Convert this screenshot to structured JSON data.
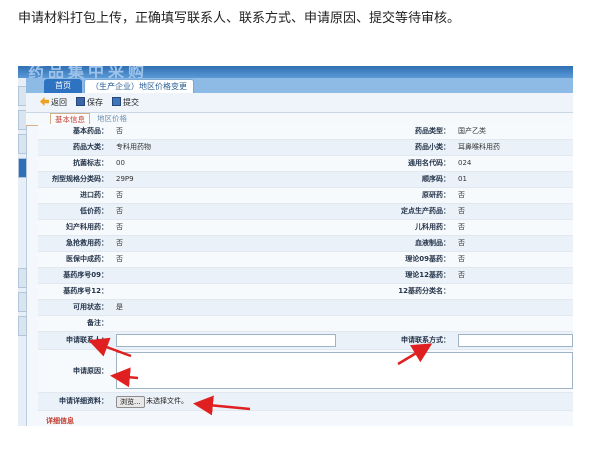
{
  "instruction": "申请材料打包上传，正确填写联系人、联系方式、申请原因、提交等待审核。",
  "banner_text": "药品集中采购",
  "tabs": {
    "home": "首页",
    "current": "（生产企业）地区价格变更"
  },
  "toolbar": {
    "back": "返回",
    "save": "保存",
    "submit": "提交"
  },
  "subtabs": {
    "basic": "基本信息",
    "regional_price": "地区价格"
  },
  "form": {
    "rows": [
      {
        "l1": "基本药品：",
        "v1": "否",
        "l2": "药品类型：",
        "v2": "国产乙类"
      },
      {
        "l1": "药品大类：",
        "v1": "专科用药物",
        "l2": "药品小类：",
        "v2": "耳鼻喉科用药"
      },
      {
        "l1": "抗菌标志：",
        "v1": "00",
        "l2": "通用名代码：",
        "v2": "024"
      },
      {
        "l1": "剂型规格分类码：",
        "v1": "29P9",
        "l2": "顺序码：",
        "v2": "01"
      },
      {
        "l1": "进口药：",
        "v1": "否",
        "l2": "原研药：",
        "v2": "否"
      },
      {
        "l1": "低价药：",
        "v1": "否",
        "l2": "定点生产药品：",
        "v2": "否"
      },
      {
        "l1": "妇产科用药：",
        "v1": "否",
        "l2": "儿科用药：",
        "v2": "否"
      },
      {
        "l1": "急抢救用药：",
        "v1": "否",
        "l2": "血液制品：",
        "v2": "否"
      },
      {
        "l1": "医保中成药：",
        "v1": "否",
        "l2": "理论09基药：",
        "v2": "否"
      },
      {
        "l1": "基药序号09：",
        "v1": "",
        "l2": "理论12基药：",
        "v2": "否"
      },
      {
        "l1": "基药序号12：",
        "v1": "",
        "l2": "12基药分类名：",
        "v2": ""
      },
      {
        "l1": "可用状态：",
        "v1": "是",
        "l2": "",
        "v2": ""
      },
      {
        "l1": "备注：",
        "v1": "",
        "l2": "",
        "v2": ""
      }
    ],
    "contact_label": "申请联系人：",
    "contact_method_label": "申请联系方式：",
    "contact_value": "",
    "contact_method_value": "",
    "reason_label": "申请原因：",
    "reason_value": "",
    "attachment_label": "申请详细资料：",
    "browse_label": "浏览...",
    "no_file_text": "未选择文件。"
  },
  "detail_label": "详细信息",
  "colors": {
    "banner": "#2f6fb3",
    "tab_active": "#2e72c2",
    "arrow": "#e02020",
    "label": "#24344a"
  }
}
